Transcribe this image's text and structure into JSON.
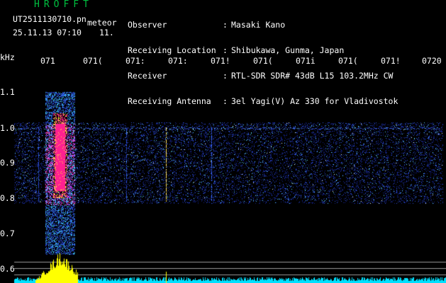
{
  "header": {
    "app_title": "HROFFT",
    "file_name": "UT2511130710.pn",
    "meteor_label": "meteor",
    "datetime": "25.11.13 07:10",
    "count": "11."
  },
  "station_info": [
    {
      "label": "Observer",
      "sep": ":",
      "value": "Masaki Kano"
    },
    {
      "label": "Receiving Location",
      "sep": ":",
      "value": "Shibukawa, Gunma, Japan"
    },
    {
      "label": "Receiver",
      "sep": ":",
      "value": "RTL-SDR SDR# 43dB L15 103.2MHz CW"
    },
    {
      "label": "Receiving Antenna",
      "sep": ":",
      "value": "3el Yagi(V) Az 330 for Vladivostok"
    }
  ],
  "y_axis": {
    "unit": "kHz",
    "labels": [
      "1.1",
      "1.0",
      "0.9",
      "0.8",
      "0.7",
      "0.6"
    ]
  },
  "x_axis": {
    "labels": [
      "071",
      "071(",
      "071:",
      "071:",
      "071!",
      "071(",
      "071i",
      "071(",
      "071!",
      "0720"
    ]
  },
  "colors": {
    "background": "#000000",
    "noise": "#1a2a9a",
    "meteor_core": "#ff2090",
    "level_trace": "#00e0ff",
    "level_burst": "#ffff00",
    "title_green": "#00c040"
  }
}
